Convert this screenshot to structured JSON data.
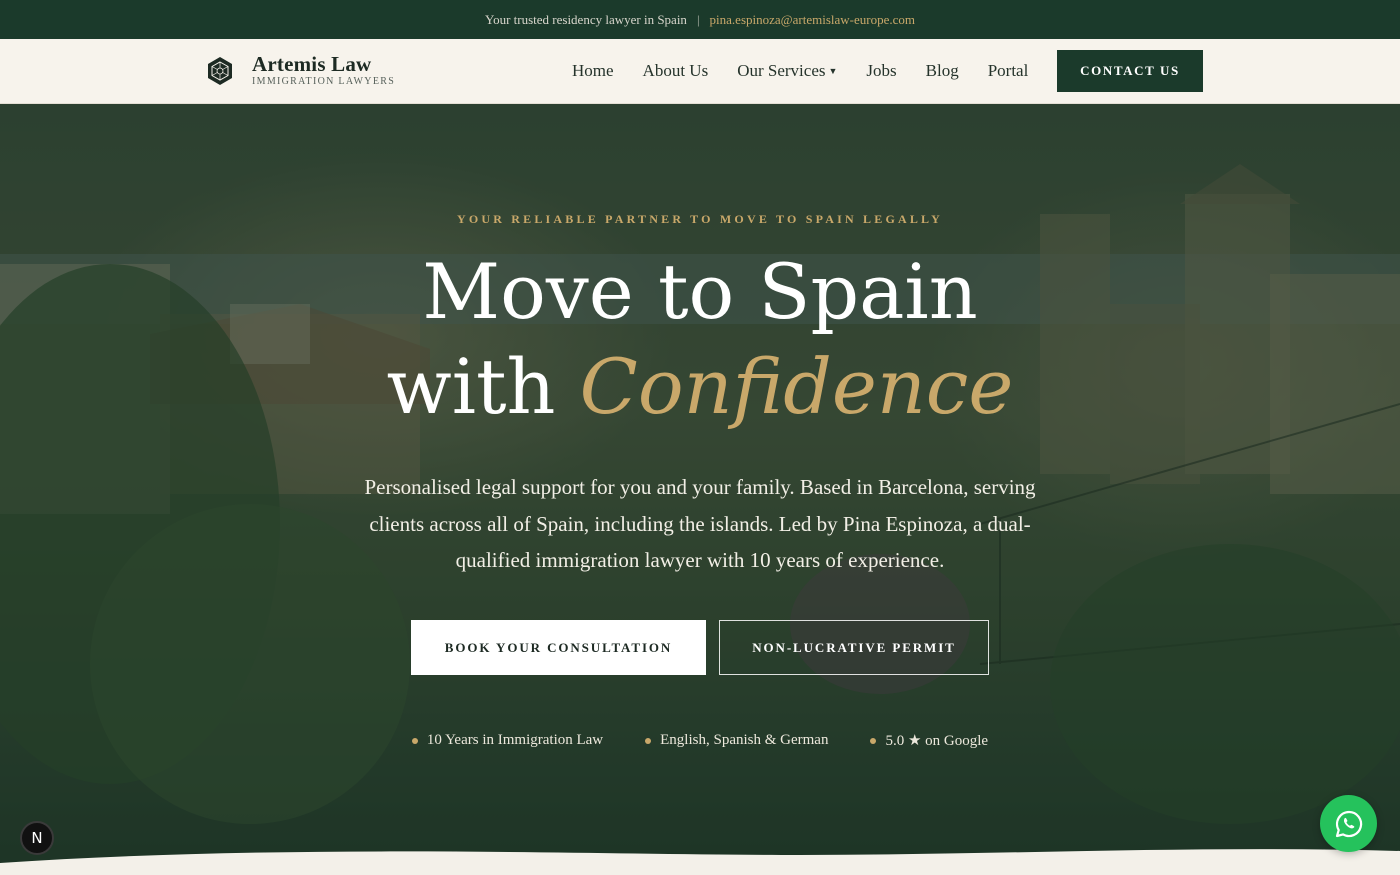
{
  "topbar": {
    "tagline": "Your trusted residency lawyer in Spain",
    "separator": "|",
    "email": "pina.espinoza@artemislaw-europe.com"
  },
  "header": {
    "brand_name": "Artemis Law",
    "brand_tagline": "IMMIGRATION LAWYERS",
    "logo_icon": "hexagon-emblem-icon",
    "nav": [
      {
        "label": "Home"
      },
      {
        "label": "About Us"
      },
      {
        "label": "Our Services",
        "has_dropdown": true
      },
      {
        "label": "Jobs"
      },
      {
        "label": "Blog"
      },
      {
        "label": "Portal"
      }
    ],
    "contact_label": "CONTACT US"
  },
  "hero": {
    "eyebrow": "YOUR RELIABLE PARTNER TO MOVE TO SPAIN LEGALLY",
    "headline_line1": "Move to Spain",
    "headline_line2_plain": "with",
    "headline_line2_accent": "Confidence",
    "lede": "Personalised legal support for you and your family. Based in Barcelona, serving clients across all of Spain, including the islands. Led by Pina Espinoza, a dual-qualified immigration lawyer with 10 years of experience.",
    "primary_cta": "BOOK YOUR CONSULTATION",
    "secondary_cta": "NON-LUCRATIVE PERMIT",
    "badges": [
      {
        "text": "10 Years in Immigration Law"
      },
      {
        "text": "English, Spanish & German"
      },
      {
        "text": "5.0 ★ on Google"
      }
    ]
  },
  "floating": {
    "dev_badge_letter": "N",
    "whatsapp_icon": "whatsapp-icon"
  },
  "colors": {
    "brand_green": "#1b3a2b",
    "gold": "#c9a86a",
    "cream": "#f7f3ec",
    "whatsapp": "#25c25c"
  }
}
